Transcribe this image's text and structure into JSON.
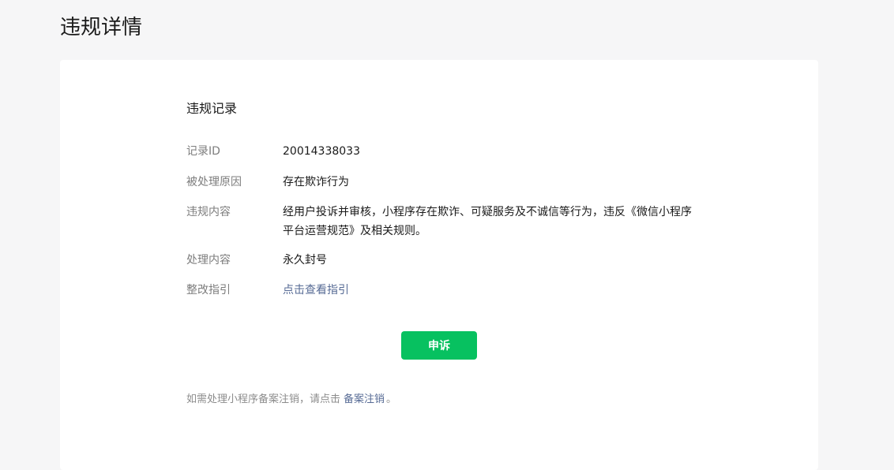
{
  "header": {
    "title": "违规详情"
  },
  "record": {
    "section_title": "违规记录",
    "fields": {
      "id": {
        "label": "记录ID",
        "value": "20014338033"
      },
      "reason": {
        "label": "被处理原因",
        "value": "存在欺诈行为"
      },
      "content": {
        "label": "违规内容",
        "value_line1": "经用户投诉并审核，小程序存在欺诈、可疑服务及不诚信等行为，违反《微信小程序",
        "value_line2": "平台运营规范》及相关规则。"
      },
      "action": {
        "label": "处理内容",
        "value": "永久封号"
      },
      "guide": {
        "label": "整改指引",
        "link_text": "点击查看指引"
      }
    }
  },
  "actions": {
    "appeal_label": "申诉"
  },
  "footer": {
    "prefix": "如需处理小程序备案注销，请点击",
    "link_text": "备案注销",
    "suffix": "。"
  },
  "colors": {
    "primary_green": "#07c160",
    "link_blue": "#576b95",
    "label_gray": "#7d7d7d",
    "background": "#f6f6f7"
  }
}
